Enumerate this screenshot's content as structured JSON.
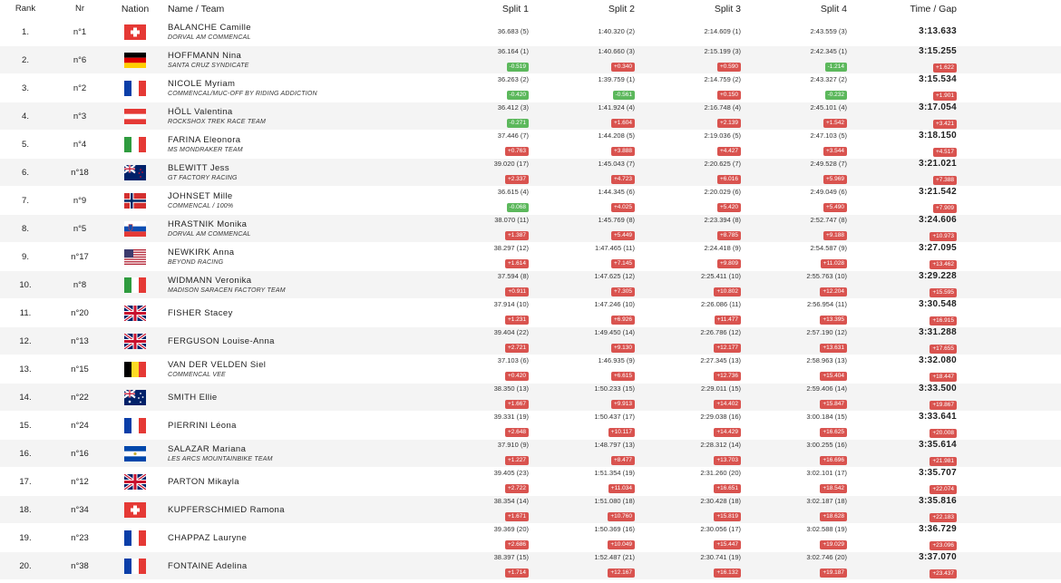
{
  "headers": {
    "rank": "Rank",
    "nr": "Nr",
    "nation": "Nation",
    "name": "Name / Team",
    "split1": "Split 1",
    "split2": "Split 2",
    "split3": "Split 3",
    "split4": "Split 4",
    "time": "Time / Gap"
  },
  "rows": [
    {
      "rank": "1.",
      "nr": "n°1",
      "flag": "sui",
      "name": "BALANCHE Camille",
      "team": "DORVAL AM COMMENCAL",
      "s1": "36.683 (5)",
      "g1": "",
      "s2": "1:40.320 (2)",
      "g2": "",
      "s3": "2:14.609 (1)",
      "g3": "",
      "s4": "2:43.559 (3)",
      "g4": "",
      "time": "3:13.633",
      "gap": ""
    },
    {
      "rank": "2.",
      "nr": "n°6",
      "flag": "ger",
      "name": "HOFFMANN Nina",
      "team": "SANTA CRUZ SYNDICATE",
      "s1": "36.164 (1)",
      "g1": "-0.519",
      "s2": "1:40.660 (3)",
      "g2": "+0.340",
      "s3": "2:15.199 (3)",
      "g3": "+0.590",
      "s4": "2:42.345 (1)",
      "g4": "-1.214",
      "time": "3:15.255",
      "gap": "+1.622"
    },
    {
      "rank": "3.",
      "nr": "n°2",
      "flag": "fra",
      "name": "NICOLE Myriam",
      "team": "COMMENCAL/MUC-OFF BY RIDING ADDICTION",
      "s1": "36.263 (2)",
      "g1": "-0.420",
      "s2": "1:39.759 (1)",
      "g2": "-0.561",
      "s3": "2:14.759 (2)",
      "g3": "+0.150",
      "s4": "2:43.327 (2)",
      "g4": "-0.232",
      "time": "3:15.534",
      "gap": "+1.901"
    },
    {
      "rank": "4.",
      "nr": "n°3",
      "flag": "aut",
      "name": "HÖLL Valentina",
      "team": "ROCKSHOX TREK RACE TEAM",
      "s1": "36.412 (3)",
      "g1": "-0.271",
      "s2": "1:41.924 (4)",
      "g2": "+1.604",
      "s3": "2:16.748 (4)",
      "g3": "+2.139",
      "s4": "2:45.101 (4)",
      "g4": "+1.542",
      "time": "3:17.054",
      "gap": "+3.421"
    },
    {
      "rank": "5.",
      "nr": "n°4",
      "flag": "ita",
      "name": "FARINA Eleonora",
      "team": "MS MONDRAKER TEAM",
      "s1": "37.446 (7)",
      "g1": "+0.763",
      "s2": "1:44.208 (5)",
      "g2": "+3.888",
      "s3": "2:19.036 (5)",
      "g3": "+4.427",
      "s4": "2:47.103 (5)",
      "g4": "+3.544",
      "time": "3:18.150",
      "gap": "+4.517"
    },
    {
      "rank": "6.",
      "nr": "n°18",
      "flag": "nzl",
      "name": "BLEWITT Jess",
      "team": "GT FACTORY RACING",
      "s1": "39.020 (17)",
      "g1": "+2.337",
      "s2": "1:45.043 (7)",
      "g2": "+4.723",
      "s3": "2:20.625 (7)",
      "g3": "+6.016",
      "s4": "2:49.528 (7)",
      "g4": "+5.969",
      "time": "3:21.021",
      "gap": "+7.388"
    },
    {
      "rank": "7.",
      "nr": "n°9",
      "flag": "nor",
      "name": "JOHNSET Mille",
      "team": "COMMENCAL / 100%",
      "s1": "36.615 (4)",
      "g1": "-0.068",
      "s2": "1:44.345 (6)",
      "g2": "+4.025",
      "s3": "2:20.029 (6)",
      "g3": "+5.420",
      "s4": "2:49.049 (6)",
      "g4": "+5.490",
      "time": "3:21.542",
      "gap": "+7.909"
    },
    {
      "rank": "8.",
      "nr": "n°5",
      "flag": "slo",
      "name": "HRASTNIK Monika",
      "team": "DORVAL AM COMMENCAL",
      "s1": "38.070 (11)",
      "g1": "+1.387",
      "s2": "1:45.769 (8)",
      "g2": "+5.449",
      "s3": "2:23.394 (8)",
      "g3": "+8.785",
      "s4": "2:52.747 (8)",
      "g4": "+9.188",
      "time": "3:24.606",
      "gap": "+10.973"
    },
    {
      "rank": "9.",
      "nr": "n°17",
      "flag": "usa",
      "name": "NEWKIRK Anna",
      "team": "BEYOND RACING",
      "s1": "38.297 (12)",
      "g1": "+1.614",
      "s2": "1:47.465 (11)",
      "g2": "+7.145",
      "s3": "2:24.418 (9)",
      "g3": "+9.809",
      "s4": "2:54.587 (9)",
      "g4": "+11.028",
      "time": "3:27.095",
      "gap": "+13.462"
    },
    {
      "rank": "10.",
      "nr": "n°8",
      "flag": "ita",
      "name": "WIDMANN Veronika",
      "team": "MADISON SARACEN FACTORY TEAM",
      "s1": "37.594 (8)",
      "g1": "+0.911",
      "s2": "1:47.625 (12)",
      "g2": "+7.305",
      "s3": "2:25.411 (10)",
      "g3": "+10.802",
      "s4": "2:55.763 (10)",
      "g4": "+12.204",
      "time": "3:29.228",
      "gap": "+15.595"
    },
    {
      "rank": "11.",
      "nr": "n°20",
      "flag": "gbr",
      "name": "FISHER Stacey",
      "team": "",
      "s1": "37.914 (10)",
      "g1": "+1.231",
      "s2": "1:47.246 (10)",
      "g2": "+6.926",
      "s3": "2:26.086 (11)",
      "g3": "+11.477",
      "s4": "2:56.954 (11)",
      "g4": "+13.395",
      "time": "3:30.548",
      "gap": "+16.915"
    },
    {
      "rank": "12.",
      "nr": "n°13",
      "flag": "gbr",
      "name": "FERGUSON Louise-Anna",
      "team": "",
      "s1": "39.404 (22)",
      "g1": "+2.721",
      "s2": "1:49.450 (14)",
      "g2": "+9.130",
      "s3": "2:26.786 (12)",
      "g3": "+12.177",
      "s4": "2:57.190 (12)",
      "g4": "+13.631",
      "time": "3:31.288",
      "gap": "+17.655"
    },
    {
      "rank": "13.",
      "nr": "n°15",
      "flag": "bel",
      "name": "VAN DER VELDEN Siel",
      "team": "COMMENCAL VEE",
      "s1": "37.103 (6)",
      "g1": "+0.420",
      "s2": "1:46.935 (9)",
      "g2": "+6.615",
      "s3": "2:27.345 (13)",
      "g3": "+12.736",
      "s4": "2:58.963 (13)",
      "g4": "+15.404",
      "time": "3:32.080",
      "gap": "+18.447"
    },
    {
      "rank": "14.",
      "nr": "n°22",
      "flag": "aus",
      "name": "SMITH Ellie",
      "team": "",
      "s1": "38.350 (13)",
      "g1": "+1.667",
      "s2": "1:50.233 (15)",
      "g2": "+9.913",
      "s3": "2:29.011 (15)",
      "g3": "+14.402",
      "s4": "2:59.406 (14)",
      "g4": "+15.847",
      "time": "3:33.500",
      "gap": "+19.867"
    },
    {
      "rank": "15.",
      "nr": "n°24",
      "flag": "fra",
      "name": "PIERRINI Léona",
      "team": "",
      "s1": "39.331 (19)",
      "g1": "+2.648",
      "s2": "1:50.437 (17)",
      "g2": "+10.117",
      "s3": "2:29.038 (16)",
      "g3": "+14.429",
      "s4": "3:00.184 (15)",
      "g4": "+16.625",
      "time": "3:33.641",
      "gap": "+20.008"
    },
    {
      "rank": "16.",
      "nr": "n°16",
      "flag": "esa",
      "name": "SALAZAR Mariana",
      "team": "LES ARCS MOUNTAINBIKE TEAM",
      "s1": "37.910 (9)",
      "g1": "+1.227",
      "s2": "1:48.797 (13)",
      "g2": "+8.477",
      "s3": "2:28.312 (14)",
      "g3": "+13.703",
      "s4": "3:00.255 (16)",
      "g4": "+16.696",
      "time": "3:35.614",
      "gap": "+21.981"
    },
    {
      "rank": "17.",
      "nr": "n°12",
      "flag": "gbr",
      "name": "PARTON Mikayla",
      "team": "",
      "s1": "39.405 (23)",
      "g1": "+2.722",
      "s2": "1:51.354 (19)",
      "g2": "+11.034",
      "s3": "2:31.260 (20)",
      "g3": "+16.651",
      "s4": "3:02.101 (17)",
      "g4": "+18.542",
      "time": "3:35.707",
      "gap": "+22.074"
    },
    {
      "rank": "18.",
      "nr": "n°34",
      "flag": "sui",
      "name": "KUPFERSCHMIED Ramona",
      "team": "",
      "s1": "38.354 (14)",
      "g1": "+1.671",
      "s2": "1:51.080 (18)",
      "g2": "+10.760",
      "s3": "2:30.428 (18)",
      "g3": "+15.819",
      "s4": "3:02.187 (18)",
      "g4": "+18.628",
      "time": "3:35.816",
      "gap": "+22.183"
    },
    {
      "rank": "19.",
      "nr": "n°23",
      "flag": "fra",
      "name": "CHAPPAZ Lauryne",
      "team": "",
      "s1": "39.369 (20)",
      "g1": "+2.686",
      "s2": "1:50.369 (16)",
      "g2": "+10.049",
      "s3": "2:30.056 (17)",
      "g3": "+15.447",
      "s4": "3:02.588 (19)",
      "g4": "+19.029",
      "time": "3:36.729",
      "gap": "+23.096"
    },
    {
      "rank": "20.",
      "nr": "n°38",
      "flag": "fra",
      "name": "FONTAINE Adelina",
      "team": "",
      "s1": "38.397 (15)",
      "g1": "+1.714",
      "s2": "1:52.487 (21)",
      "g2": "+12.167",
      "s3": "2:30.741 (19)",
      "g3": "+16.132",
      "s4": "3:02.746 (20)",
      "g4": "+19.187",
      "time": "3:37.070",
      "gap": "+23.437"
    }
  ]
}
